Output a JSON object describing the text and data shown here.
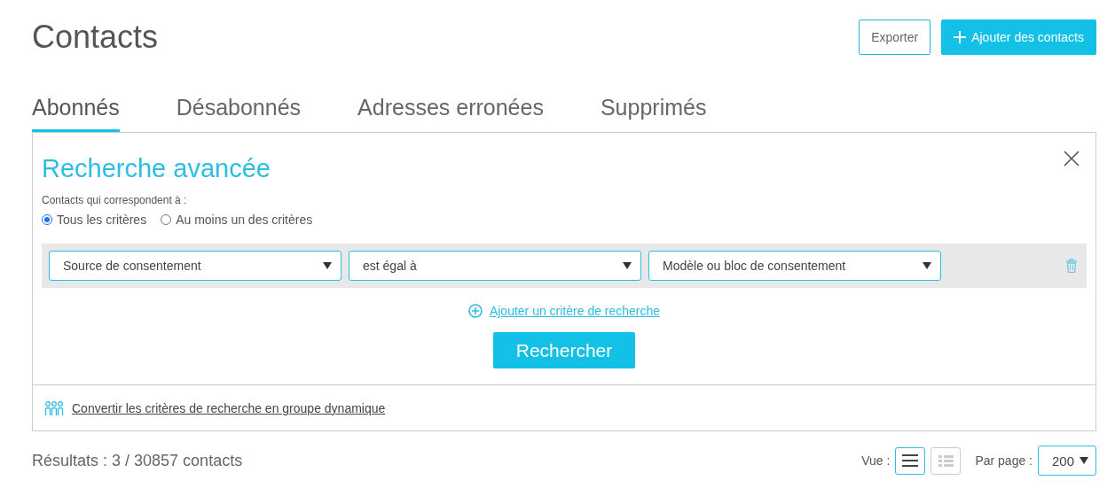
{
  "title": "Contacts",
  "actions": [
    {
      "label": "Exporter",
      "kind": "outline"
    },
    {
      "label": "Ajouter des contacts",
      "kind": "primary"
    }
  ],
  "tabs": [
    {
      "label": "Abonnés",
      "selected": true
    },
    {
      "label": "Désabonnés",
      "selected": false
    },
    {
      "label": "Adresses erronées",
      "selected": false
    },
    {
      "label": "Supprimés",
      "selected": false
    }
  ],
  "search": {
    "title": "Recherche avancée",
    "match_label": "Contacts qui correspondent à :",
    "match_options": [
      {
        "label": "Tous les critères",
        "selected": true
      },
      {
        "label": "Au moins un des critères",
        "selected": false
      }
    ],
    "criteria": [
      {
        "field": "Source de consentement",
        "operator": "est égal à",
        "value": "Modèle ou bloc de consentement"
      }
    ],
    "add_link": "Ajouter un critère de recherche",
    "submit": "Rechercher",
    "convert_link": "Convertir les critères de recherche en groupe dynamique"
  },
  "results": "Résultats : 3 / 30857 contacts",
  "view_label": "Vue :",
  "views": [
    {
      "kind": "list",
      "selected": true
    },
    {
      "kind": "detail",
      "selected": false
    }
  ],
  "per_page_label": "Par page :",
  "per_page": "200"
}
